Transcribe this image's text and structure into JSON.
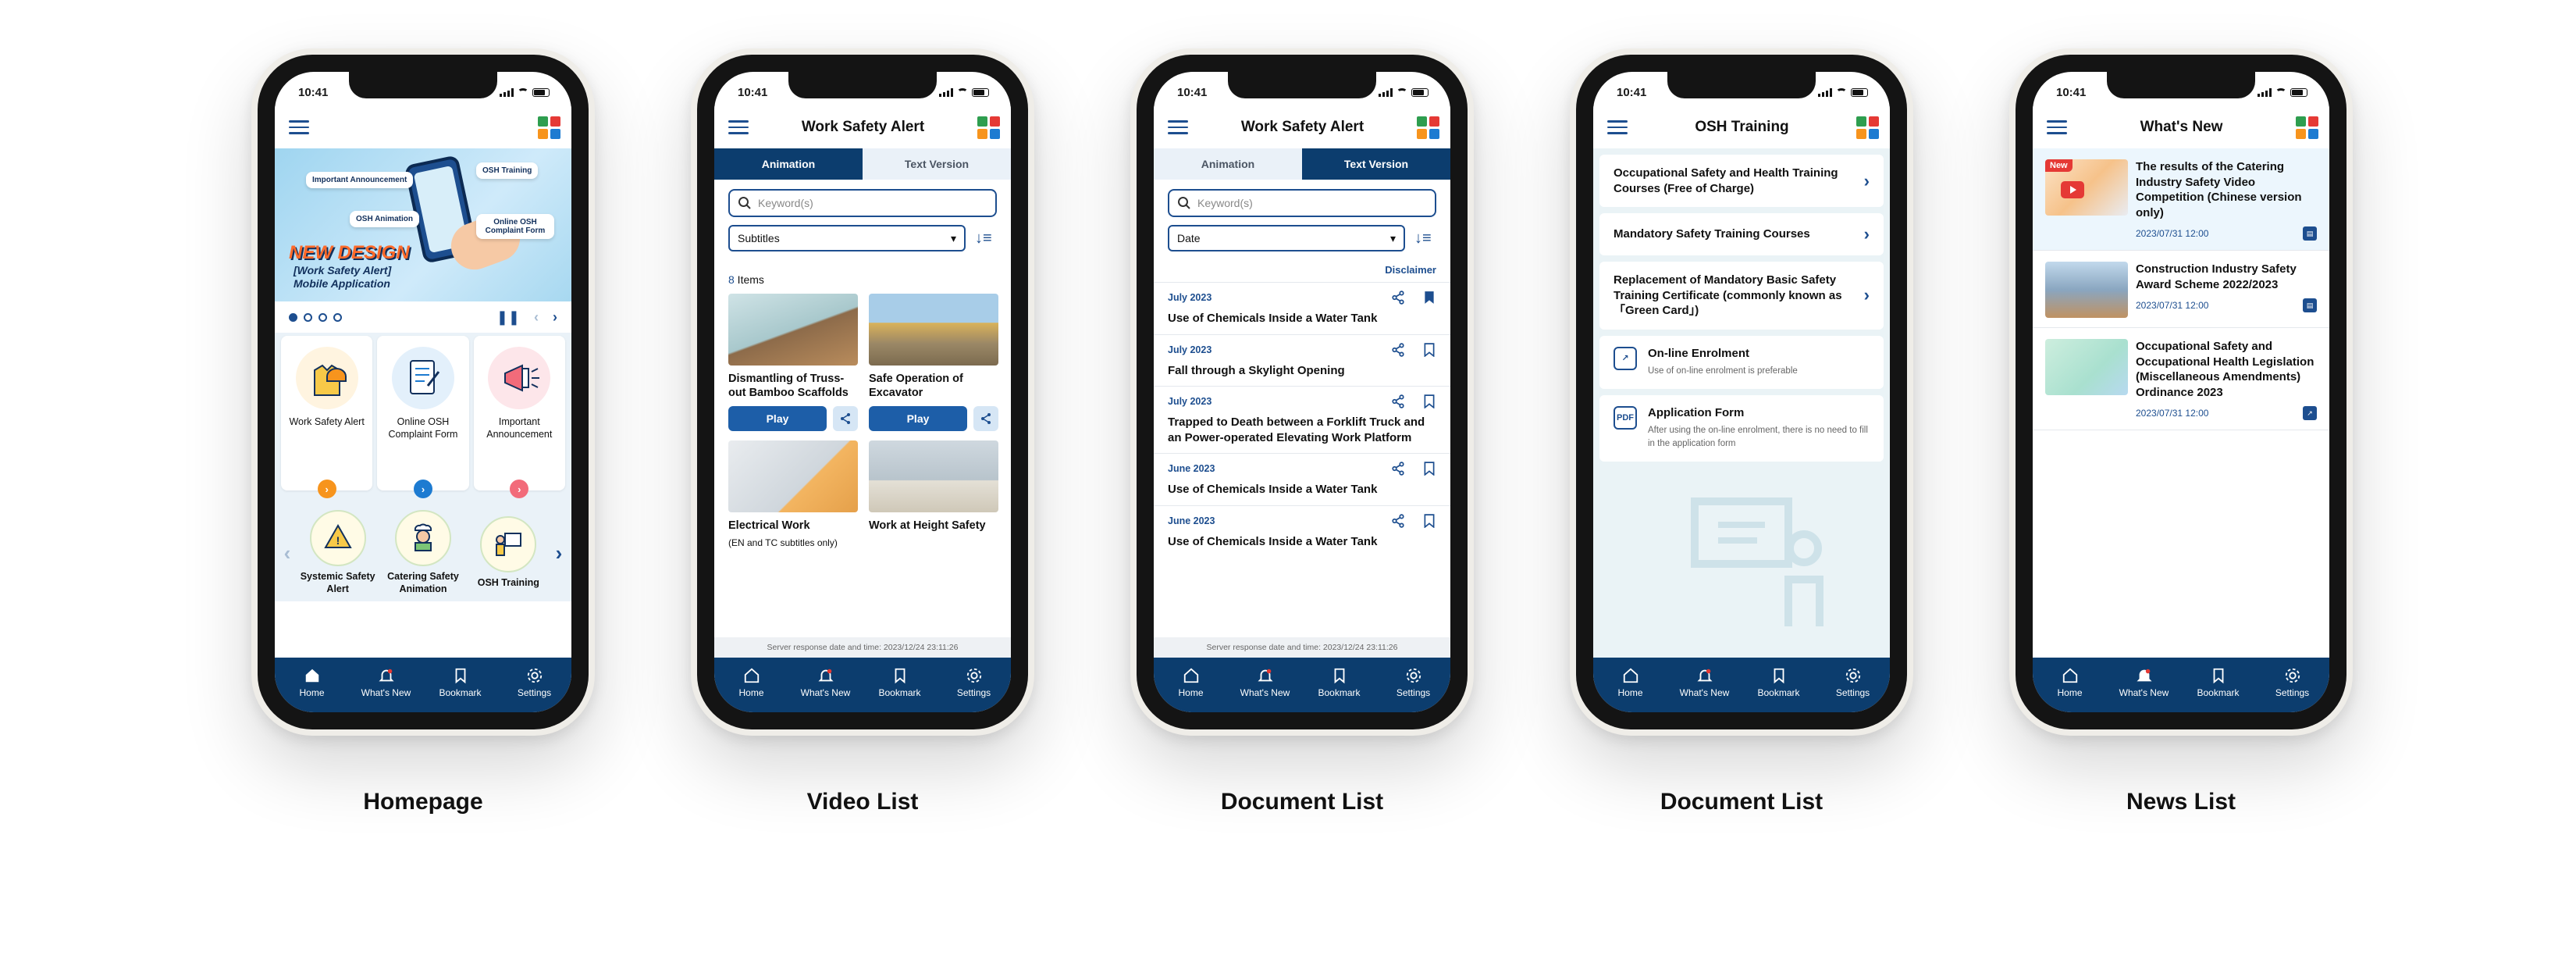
{
  "status_time": "10:41",
  "nav": {
    "home": "Home",
    "whats_new": "What's New",
    "bookmark": "Bookmark",
    "settings": "Settings"
  },
  "captions": [
    "Homepage",
    "Video List",
    "Document List",
    "Document List",
    "News List"
  ],
  "colors": {
    "primary": "#0c3d6e",
    "accent": "#1d5ea8",
    "orange": "#f7941d",
    "pink": "#f26b7a"
  },
  "home": {
    "banner": {
      "bubble_important": "Important Announcement",
      "bubble_osh_training": "OSH Training",
      "bubble_osh_animation": "OSH Animation",
      "bubble_complaint": "Online OSH Complaint Form",
      "title": "NEW DESIGN",
      "subtitle": "[Work Safety Alert] Mobile Application"
    },
    "cards": [
      {
        "label": "Work Safety Alert",
        "icon": "vest-helmet-icon"
      },
      {
        "label": "Online OSH Complaint Form",
        "icon": "complaint-form-icon"
      },
      {
        "label": "Important Announcement",
        "icon": "megaphone-icon"
      }
    ],
    "mini": [
      {
        "label": "Systemic Safety Alert"
      },
      {
        "label": "Catering Safety Animation"
      },
      {
        "label": "OSH Training"
      }
    ]
  },
  "video": {
    "title": "Work Safety Alert",
    "tab_animation": "Animation",
    "tab_text": "Text Version",
    "search_placeholder": "Keyword(s)",
    "filter": "Subtitles",
    "count": "8",
    "count_suffix": " Items",
    "play": "Play",
    "items": [
      {
        "title": "Dismantling of Truss-out Bamboo Scaffolds",
        "sub": ""
      },
      {
        "title": "Safe Operation of Excavator",
        "sub": ""
      },
      {
        "title": "Electrical Work",
        "sub": "(EN and TC subtitles only)"
      },
      {
        "title": "Work at Height Safety",
        "sub": ""
      }
    ],
    "server_time": "Server response date and time: 2023/12/24 23:11:26"
  },
  "docs": {
    "title": "Work Safety Alert",
    "tab_animation": "Animation",
    "tab_text": "Text Version",
    "search_placeholder": "Keyword(s)",
    "filter": "Date",
    "disclaimer": "Disclaimer",
    "items": [
      {
        "date": "July 2023",
        "title": "Use of Chemicals Inside a  Water Tank",
        "bookmarked": true
      },
      {
        "date": "July 2023",
        "title": "Fall through a Skylight Opening",
        "bookmarked": false
      },
      {
        "date": "July 2023",
        "title": "Trapped to Death between a Forklift Truck and an Power-operated Elevating Work Platform",
        "bookmarked": false
      },
      {
        "date": "June 2023",
        "title": "Use of Chemicals Inside a  Water Tank",
        "bookmarked": false
      },
      {
        "date": "June 2023",
        "title": "Use of Chemicals Inside a  Water Tank",
        "bookmarked": false
      }
    ],
    "server_time": "Server response date and time: 2023/12/24 23:11:26"
  },
  "osh": {
    "title": "OSH Training",
    "links": [
      {
        "title": "Occupational Safety and Health Training Courses (Free of Charge)"
      },
      {
        "title": "Mandatory Safety Training Courses"
      },
      {
        "title": "Replacement of Mandatory Basic Safety Training Certificate (commonly known as 「Green Card」)"
      }
    ],
    "enrol_title": "On-line Enrolment",
    "enrol_sub": "Use of on-line enrolment is preferable",
    "form_title": "Application Form",
    "form_sub": "After using the on-line enrolment, there is no need to fill in the application form",
    "pdf_label": "PDF"
  },
  "news": {
    "title": "What's New",
    "new_badge": "New",
    "items": [
      {
        "title": "The results of the Catering Industry Safety Video Competition (Chinese version only)",
        "meta": "2023/07/31  12:00"
      },
      {
        "title": "Construction Industry Safety Award Scheme 2022/2023",
        "meta": "2023/07/31  12:00"
      },
      {
        "title": "Occupational Safety and Occupational Health Legislation (Miscellaneous Amendments) Ordinance 2023",
        "meta": "2023/07/31  12:00"
      }
    ]
  }
}
